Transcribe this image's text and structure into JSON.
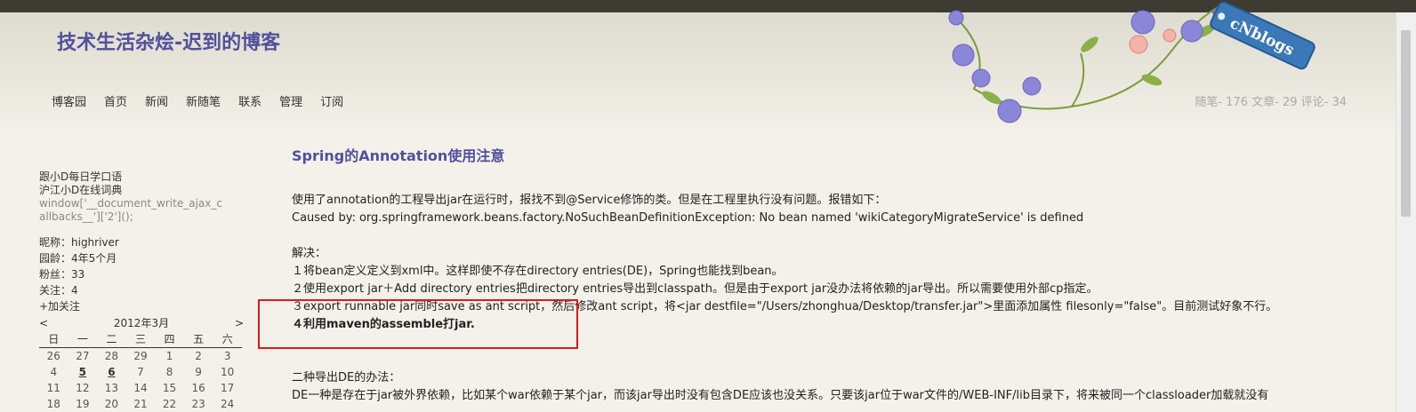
{
  "blog": {
    "title": "技术生活杂烩-迟到的博客"
  },
  "nav": [
    "博客园",
    "首页",
    "新闻",
    "新随笔",
    "联系",
    "管理",
    "订阅"
  ],
  "stats": "随笔- 176  文章- 29  评论- 34",
  "badge": "cNblogs",
  "sidebar": {
    "links": [
      "跟小D每日学口语",
      "沪江小D在线词典"
    ],
    "code_lines": [
      "window['__document_write_ajax_c",
      "allbacks__']['2']();"
    ],
    "profile": [
      "昵称：highriver",
      "园龄：4年5个月",
      "粉丝：33",
      "关注：4",
      "+加关注"
    ]
  },
  "calendar": {
    "prev": "<",
    "title": "2012年3月",
    "next": ">",
    "weekdays": [
      "日",
      "一",
      "二",
      "三",
      "四",
      "五",
      "六"
    ],
    "rows": [
      [
        "26",
        "27",
        "28",
        "29",
        "1",
        "2",
        "3"
      ],
      [
        "4",
        "5",
        "6",
        "7",
        "8",
        "9",
        "10"
      ],
      [
        "11",
        "12",
        "13",
        "14",
        "15",
        "16",
        "17"
      ],
      [
        "18",
        "19",
        "20",
        "21",
        "22",
        "23",
        "24"
      ]
    ]
  },
  "post": {
    "title": "Spring的Annotation使用注意",
    "lines": [
      "使用了annotation的工程导出jar在运行时，报找不到@Service修饰的类。但是在工程里执行没有问题。报错如下：",
      "Caused by: org.springframework.beans.factory.NoSuchBeanDefinitionException: No bean named 'wikiCategoryMigrateService' is defined",
      "",
      "解决：",
      "１将bean定义定义到xml中。这样即使不存在directory entries(DE)，Spring也能找到bean。",
      "２使用export jar＋Add directory entries把directory entries导出到classpath。但是由于export jar没办法将依赖的jar导出。所以需要使用外部cp指定。",
      "３export runnable jar同时save as ant script，然后修改ant script，将<jar destfile=\"/Users/zhonghua/Desktop/transfer.jar\">里面添加属性 filesonly=\"false\"。目前测试好象不行。",
      "４利用maven的assemble打jar.",
      "",
      "",
      "二种导出DE的办法：",
      "DE一种是存在于jar被外界依赖，比如某个war依赖于某个jar，而该jar导出时没有包含DE应该也没关系。只要该jar位于war文件的/WEB-INF/lib目录下，将来被同一个classloader加载就没有"
    ]
  }
}
